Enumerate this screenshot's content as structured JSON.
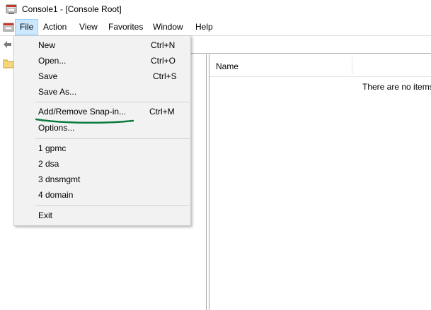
{
  "window": {
    "title": "Console1 - [Console Root]"
  },
  "menubar": {
    "items": [
      "File",
      "Action",
      "View",
      "Favorites",
      "Window",
      "Help"
    ],
    "active": "File"
  },
  "file_menu": {
    "items": [
      {
        "label": "New",
        "shortcut": "Ctrl+N"
      },
      {
        "label": "Open...",
        "shortcut": "Ctrl+O"
      },
      {
        "label": "Save",
        "shortcut": "Ctrl+S"
      },
      {
        "label": "Save As...",
        "shortcut": ""
      },
      {
        "label": "Add/Remove Snap-in...",
        "shortcut": "Ctrl+M"
      },
      {
        "label": "Options...",
        "shortcut": ""
      },
      {
        "label": "1 gpmc",
        "shortcut": ""
      },
      {
        "label": "2 dsa",
        "shortcut": ""
      },
      {
        "label": "3 dnsmgmt",
        "shortcut": ""
      },
      {
        "label": "4 domain",
        "shortcut": ""
      },
      {
        "label": "Exit",
        "shortcut": ""
      }
    ]
  },
  "list_pane": {
    "column_name": "Name",
    "empty_message": "There are no items"
  },
  "colors": {
    "menu_highlight": "#cce8ff",
    "annotation": "#0b7a3e"
  },
  "icons": {
    "app": "mmc-console-icon",
    "back": "back-arrow-icon",
    "tree": "folder-icon"
  }
}
